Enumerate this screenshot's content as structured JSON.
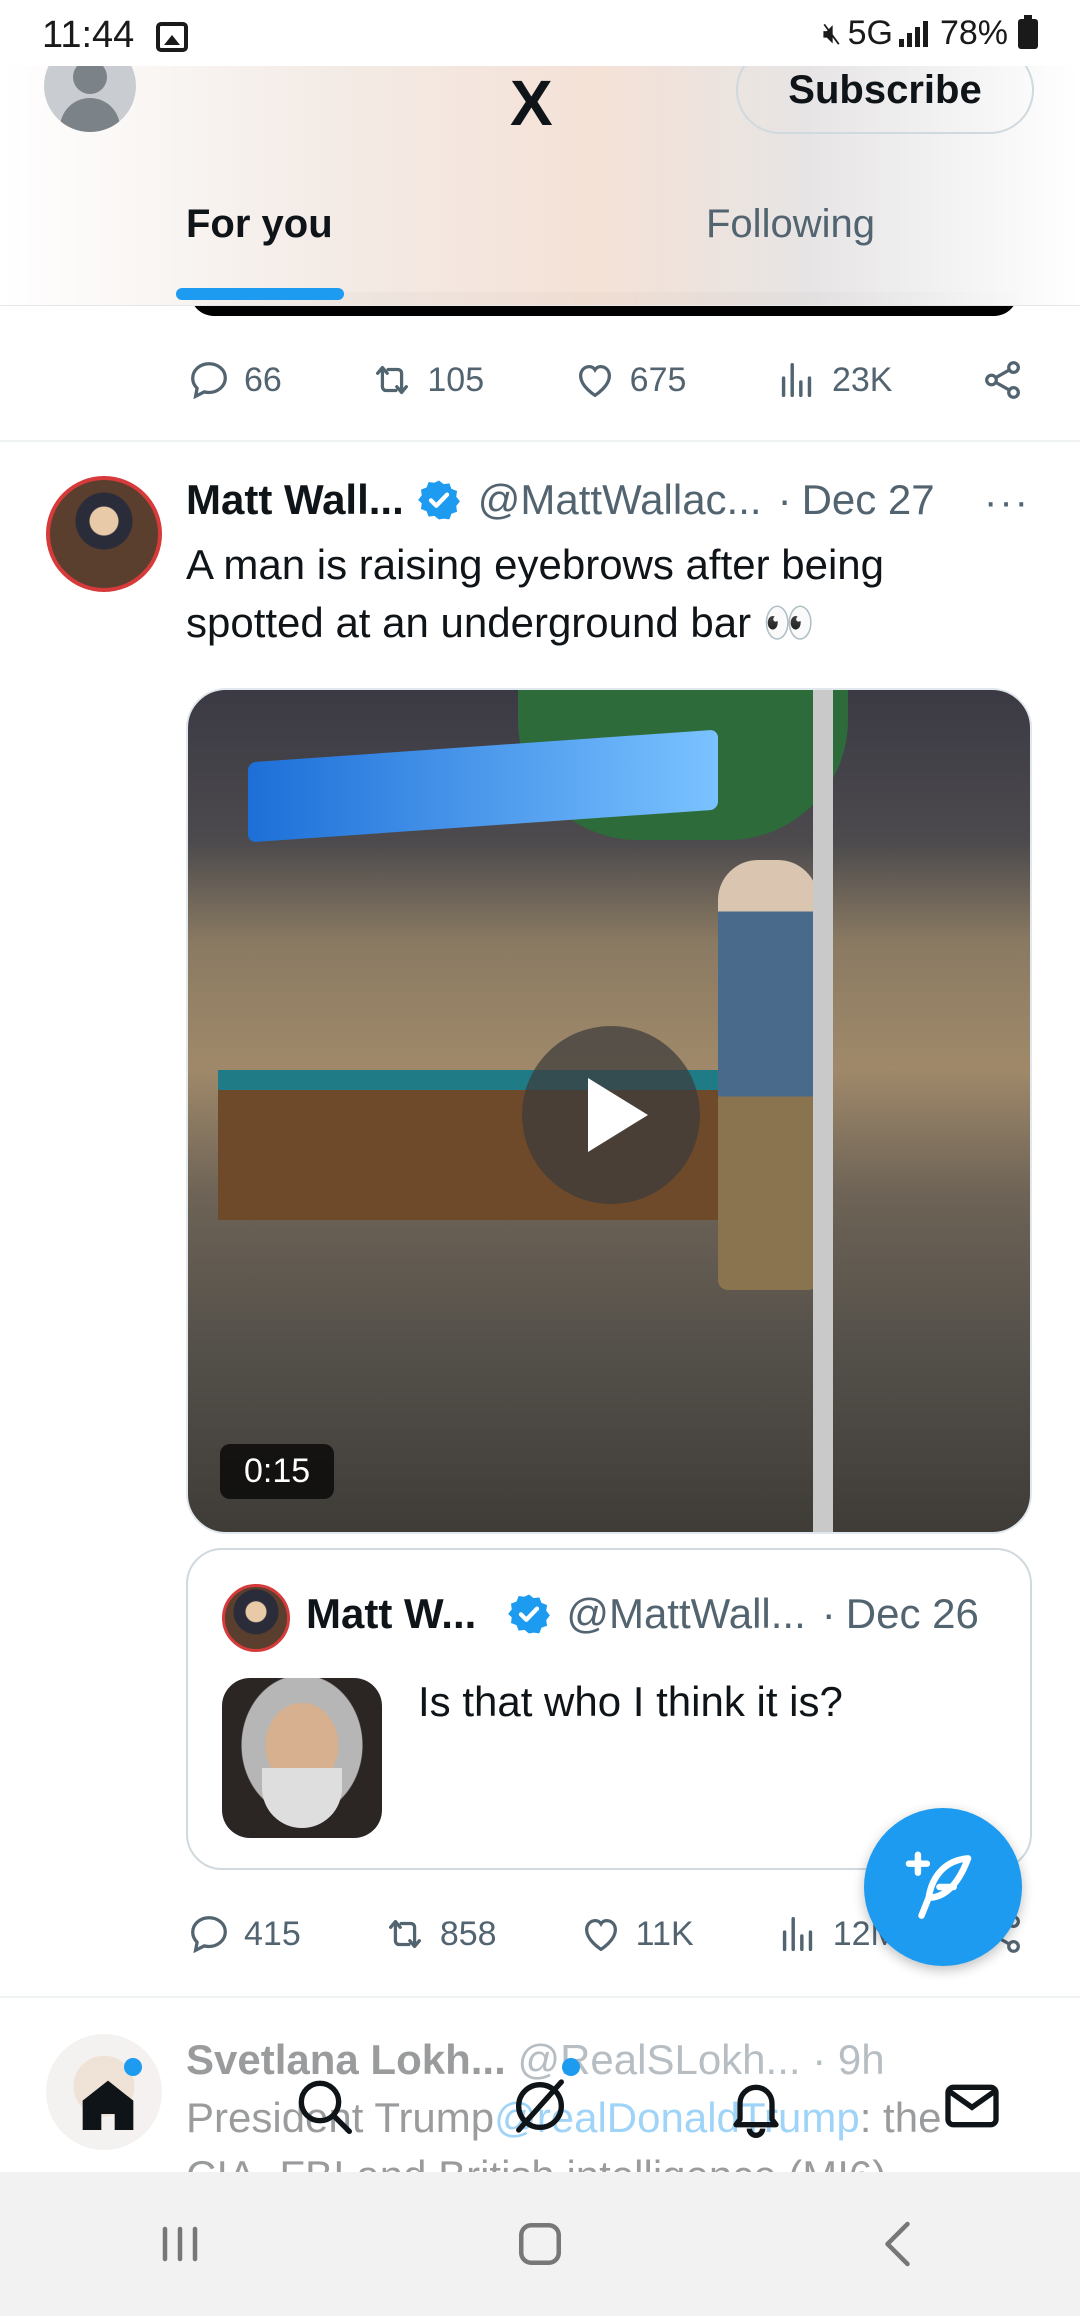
{
  "status_bar": {
    "time": "11:44",
    "network": "5G",
    "battery": "78%",
    "icons": [
      "gallery-icon",
      "mute-icon",
      "signal-icon",
      "battery-icon"
    ]
  },
  "header": {
    "logo": "X",
    "subscribe_label": "Subscribe",
    "tabs": [
      {
        "label": "For you",
        "active": true
      },
      {
        "label": "Following",
        "active": false
      }
    ]
  },
  "previous_tweet": {
    "actions": {
      "replies": "66",
      "reposts": "105",
      "likes": "675",
      "views": "23K"
    }
  },
  "tweet": {
    "name": "Matt Wall...",
    "handle": "@MattWallac...",
    "separator": "·",
    "date": "Dec 27",
    "more": "···",
    "text": "A man is raising eyebrows after being spotted at an underground bar 👀",
    "video": {
      "duration": "0:15"
    },
    "quote": {
      "name": "Matt W...",
      "handle": "@MattWall...",
      "separator": "·",
      "date": "Dec 26",
      "text": "Is that who I think it is?"
    },
    "actions": {
      "replies": "415",
      "reposts": "858",
      "likes": "11K",
      "views": "12M"
    }
  },
  "next_tweet": {
    "name": "Svetlana Lokh...",
    "handle": "@RealSLokh...",
    "separator": "·",
    "date": "9h",
    "text_before": "President Trump",
    "mention": "@realDonaldTrump",
    "text_after": ": the",
    "text_line2": "CIA, FBI and British intelligence (MI6)"
  },
  "colors": {
    "accent": "#1d9bf0",
    "text": "#0f1419",
    "muted": "#536471"
  },
  "bottom_nav": [
    "home-icon",
    "search-icon",
    "grok-icon",
    "notifications-icon",
    "messages-icon"
  ],
  "system_nav": [
    "recents-icon",
    "home-button-icon",
    "back-icon"
  ]
}
